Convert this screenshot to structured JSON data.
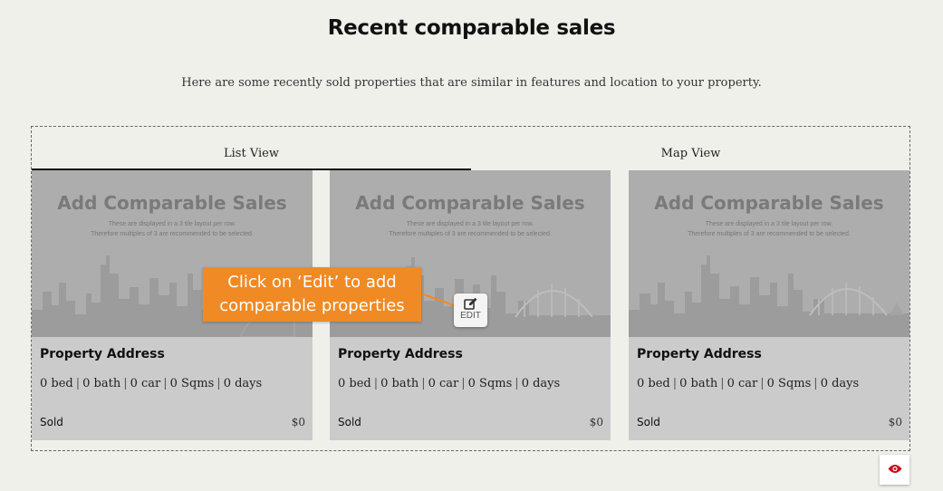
{
  "page": {
    "title": "Recent comparable sales",
    "subtitle": "Here are some recently sold properties that are similar in features and location to your property."
  },
  "tabs": [
    {
      "label": "List View",
      "active": true
    },
    {
      "label": "Map View",
      "active": false
    }
  ],
  "placeholder": {
    "heading": "Add Comparable Sales",
    "note_line1": "These are displayed in a 3 tile layout per row.",
    "note_line2": "Therefore multiples of 3 are recommended to be selected."
  },
  "cards": [
    {
      "address": "Property Address",
      "bed": "0 bed",
      "bath": "0 bath",
      "car": "0 car",
      "sqms": "0 Sqms",
      "days": "0 days",
      "status": "Sold",
      "price": "$0"
    },
    {
      "address": "Property Address",
      "bed": "0 bed",
      "bath": "0 bath",
      "car": "0 car",
      "sqms": "0 Sqms",
      "days": "0 days",
      "status": "Sold",
      "price": "$0"
    },
    {
      "address": "Property Address",
      "bed": "0 bed",
      "bath": "0 bath",
      "car": "0 car",
      "sqms": "0 Sqms",
      "days": "0 days",
      "status": "Sold",
      "price": "$0"
    }
  ],
  "edit": {
    "label": "EDIT",
    "icon": "edit-icon"
  },
  "callout": {
    "line1": "Click on ‘Edit’ to add",
    "line2": "comparable properties"
  },
  "visibility": {
    "icon": "eye-icon"
  },
  "colors": {
    "accent": "#f08a24",
    "eye": "#d0021b",
    "card_bg": "#cbcbcb",
    "image_bg": "#adadad"
  }
}
